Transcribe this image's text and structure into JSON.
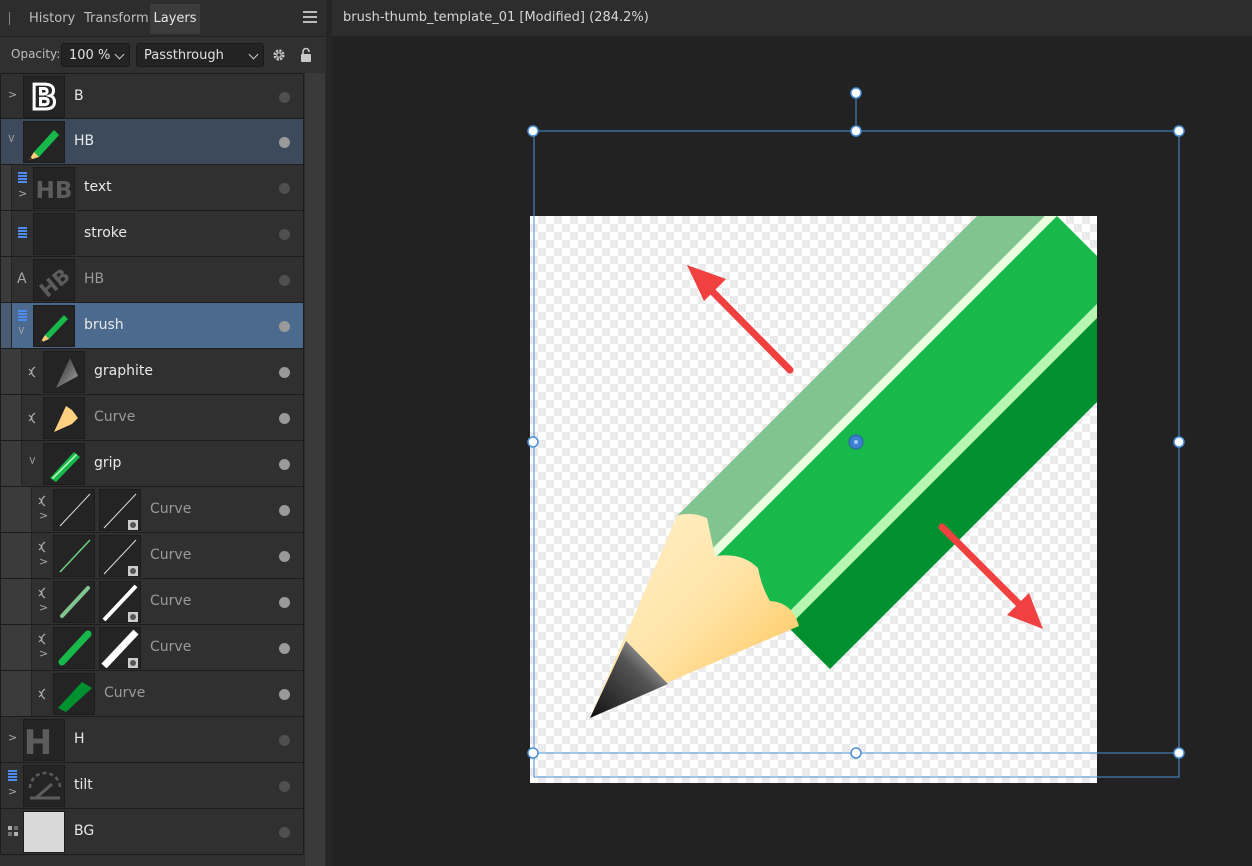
{
  "tabs": {
    "history": "History",
    "transform": "Transform",
    "layers": "Layers"
  },
  "toolbar": {
    "opacity_label": "Opacity:",
    "opacity_value": "100 %",
    "blend_mode": "Passthrough"
  },
  "layers": [
    {
      "name": "B"
    },
    {
      "name": "HB"
    },
    {
      "name": "text"
    },
    {
      "name": "stroke"
    },
    {
      "name": "HB"
    },
    {
      "name": "brush"
    },
    {
      "name": "graphite"
    },
    {
      "name": "Curve"
    },
    {
      "name": "grip"
    },
    {
      "name": "Curve"
    },
    {
      "name": "Curve"
    },
    {
      "name": "Curve"
    },
    {
      "name": "Curve"
    },
    {
      "name": "Curve"
    },
    {
      "name": "H"
    },
    {
      "name": "tilt"
    },
    {
      "name": "BG"
    }
  ],
  "thumb_text": {
    "b": "B",
    "hb": "HB",
    "hb_rot": "HB",
    "h": "H"
  },
  "type_markers": {
    "text_layer": "A"
  },
  "document": {
    "title": "brush-thumb_template_01 [Modified] (284.2%)"
  },
  "colors": {
    "selection": "#4b6a8e",
    "pencil_green": "#16b94a",
    "pencil_dark": "#009030",
    "pencil_light": "#80c48f",
    "wood": "#ffd27a",
    "arrow": "#f04040",
    "handle": "#4a90d9"
  }
}
